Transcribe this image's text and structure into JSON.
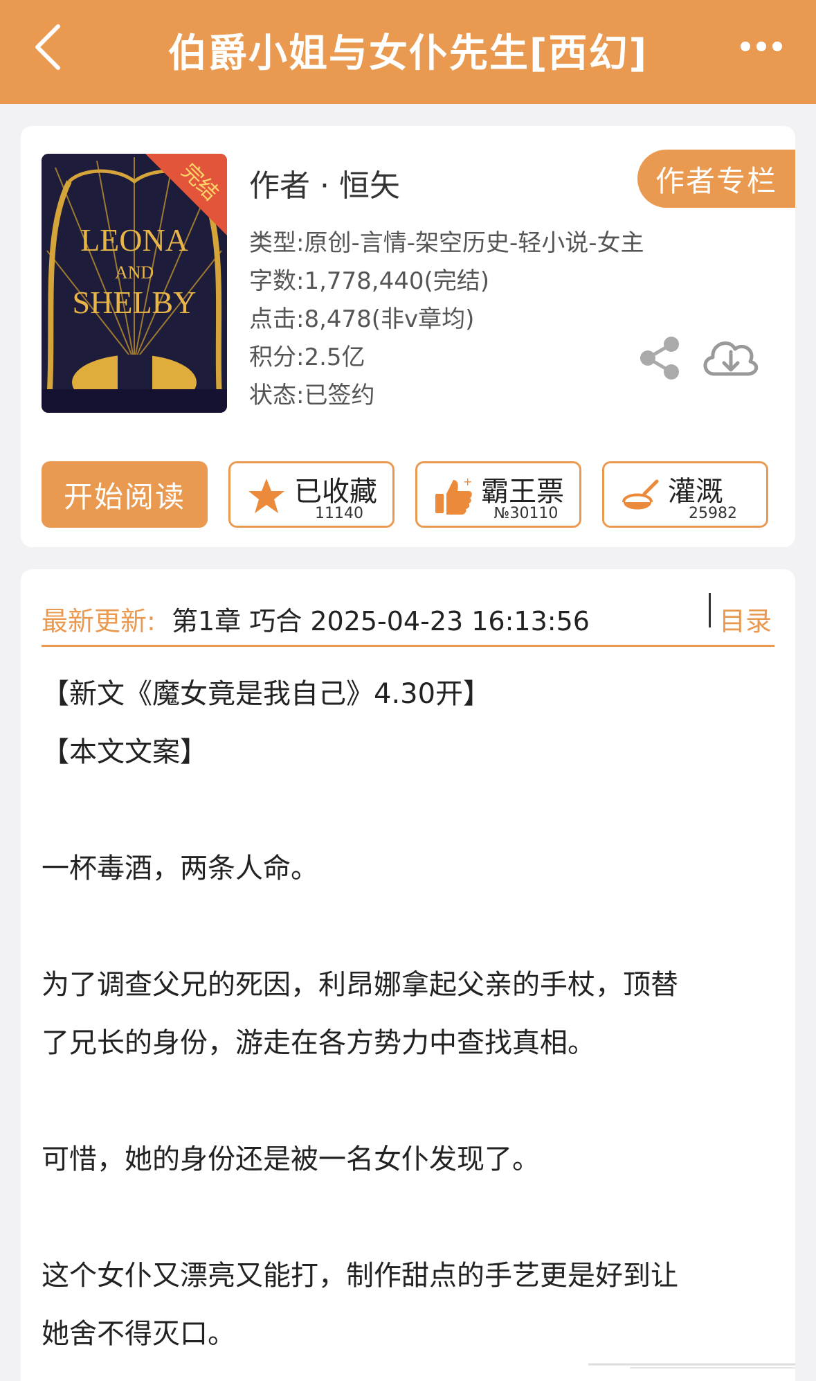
{
  "header": {
    "title": "伯爵小姐与女仆先生[西幻]",
    "accent": "#ea9a50"
  },
  "cover": {
    "badge": "完结",
    "title_line1": "LEONA",
    "title_line2": "AND",
    "title_line3": "SHELBY"
  },
  "info": {
    "author": "作者 · 恒矢",
    "author_column": "作者专栏",
    "type": "类型:原创-言情-架空历史-轻小说-女主",
    "words": "字数:1,778,440(完结)",
    "clicks": "点击:8,478(非v章均)",
    "score": "积分:2.5亿",
    "status": "状态:已签约",
    "share_icon": "share-icon",
    "download_icon": "cloud-download-icon"
  },
  "actions": {
    "read": "开始阅读",
    "favorite_label": "已收藏",
    "favorite_count": "11140",
    "vote_label": "霸王票",
    "vote_count": "№30110",
    "water_label": "灌溉",
    "water_count": "25982"
  },
  "update": {
    "label": "最新更新:",
    "text": "第1章 巧合 2025-04-23 16:13:56",
    "toc": "目录"
  },
  "summary": {
    "p1": "【新文《魔女竟是我自己》4.30开】",
    "p2": "【本文文案】",
    "p3": "一杯毒酒，两条人命。",
    "p4a": "为了调查父兄的死因，利昂娜拿起父亲的手杖，顶替",
    "p4b": "了兄长的身份，游走在各方势力中查找真相。",
    "p5": "可惜，她的身份还是被一名女仆发现了。",
    "p6a": "这个女仆又漂亮又能打，制作甜点的手艺更是好到让",
    "p6b": "她舍不得灭口。"
  }
}
